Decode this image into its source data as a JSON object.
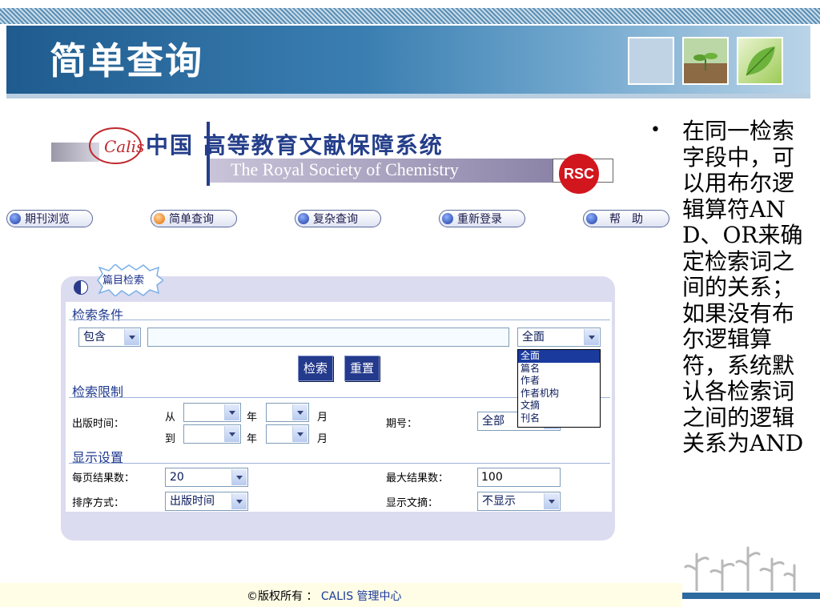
{
  "slide": {
    "title": "简单查询",
    "bullet": "在同一检索字段中，可以用布尔逻辑算符AND、OR来确定检索词之间的关系；如果没有布尔逻辑算符，系统默认各检索词之间的逻辑关系为AND"
  },
  "rsc_header": {
    "cn_title": "中国 高等教育文献保障系统",
    "en_title": "The Royal Society of Chemistry",
    "badge": "RSC",
    "logo_text": "Calis"
  },
  "nav": {
    "items": [
      {
        "label": "期刊浏览"
      },
      {
        "label": "简单查询"
      },
      {
        "label": "复杂查询"
      },
      {
        "label": "重新登录"
      },
      {
        "label": "帮　助"
      }
    ]
  },
  "search": {
    "tab_label": "篇目检索",
    "conditions_title": "检索条件",
    "match_select": "包含",
    "query_value": "",
    "field_select": "全面",
    "field_options": [
      "全面",
      "篇名",
      "作者",
      "作者机构",
      "文摘",
      "刊名"
    ],
    "search_button": "检索",
    "reset_button": "重置",
    "limits_title": "检索限制",
    "pub_time_label": "出版时间：",
    "from_label": "从",
    "to_label": "到",
    "year_label": "年",
    "month_label": "月",
    "issue_label": "期号：",
    "issue_select": "全部",
    "display_title": "显示设置",
    "per_page_label": "每页结果数：",
    "per_page_value": "20",
    "max_results_label": "最大结果数：",
    "max_results_value": "100",
    "sort_label": "排序方式：",
    "sort_value": "出版时间",
    "abstract_label": "显示文摘：",
    "abstract_value": "不显示"
  },
  "footer": {
    "copyright": "©版权所有 ：",
    "owner": "CALIS 管理中心"
  },
  "colors": {
    "banner": "#1f5b8e",
    "nav_text": "#1a1a4a",
    "section_title": "#1f3a8f",
    "button": "#243a8c",
    "panel": "#dcdcf0",
    "rsc_red": "#d2161e"
  }
}
